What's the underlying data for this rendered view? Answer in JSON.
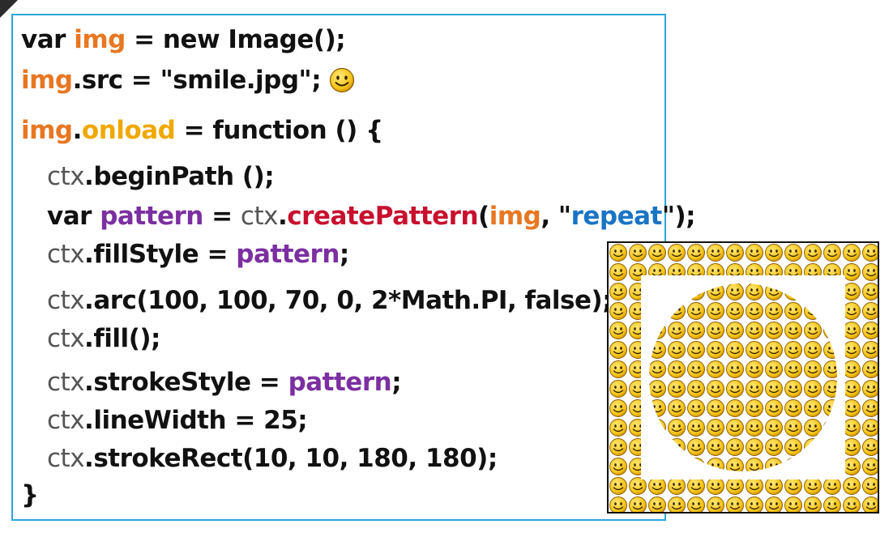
{
  "code": {
    "l1": {
      "a": "var ",
      "b": "img",
      "c": " = new Image();"
    },
    "l2": {
      "a": "img",
      "b": ".src = \"smile.jpg\";"
    },
    "l3": {
      "a": "img",
      "b": ".",
      "c": "onload",
      "d": " = function () {"
    },
    "l4": {
      "a": "ctx",
      "b": ".beginPath ();"
    },
    "l5": {
      "a": "var ",
      "b": "pattern",
      "c": " = ",
      "d": "ctx",
      "e": ".",
      "f": "createPattern",
      "g": "(",
      "h": "img",
      "i": ", \"",
      "j": "repeat",
      "k": "\");"
    },
    "l6": {
      "a": "ctx",
      "b": ".fillStyle = ",
      "c": "pattern",
      "d": ";"
    },
    "l7": {
      "a": "ctx",
      "b": ".arc(100, 100, 70, 0, 2*Math.PI, false);"
    },
    "l8": {
      "a": "ctx",
      "b": ".fill();"
    },
    "l9": {
      "a": "ctx",
      "b": ".strokeStyle = ",
      "c": "pattern",
      "d": ";"
    },
    "l10": {
      "a": "ctx",
      "b": ".lineWidth = 25;"
    },
    "l11": {
      "a": "ctx",
      "b": ".strokeRect(10, 10, 180, 180);"
    },
    "l12": {
      "a": "}"
    }
  },
  "colors": {
    "border": "#2aa7dc",
    "orange": "#e87722",
    "purple": "#7b2fa0",
    "red": "#c8102e",
    "blue": "#1a74c4",
    "smiley": "#f5c518"
  },
  "icons": {
    "inline": "smiley-icon",
    "pattern_tile": "smiley-icon"
  }
}
